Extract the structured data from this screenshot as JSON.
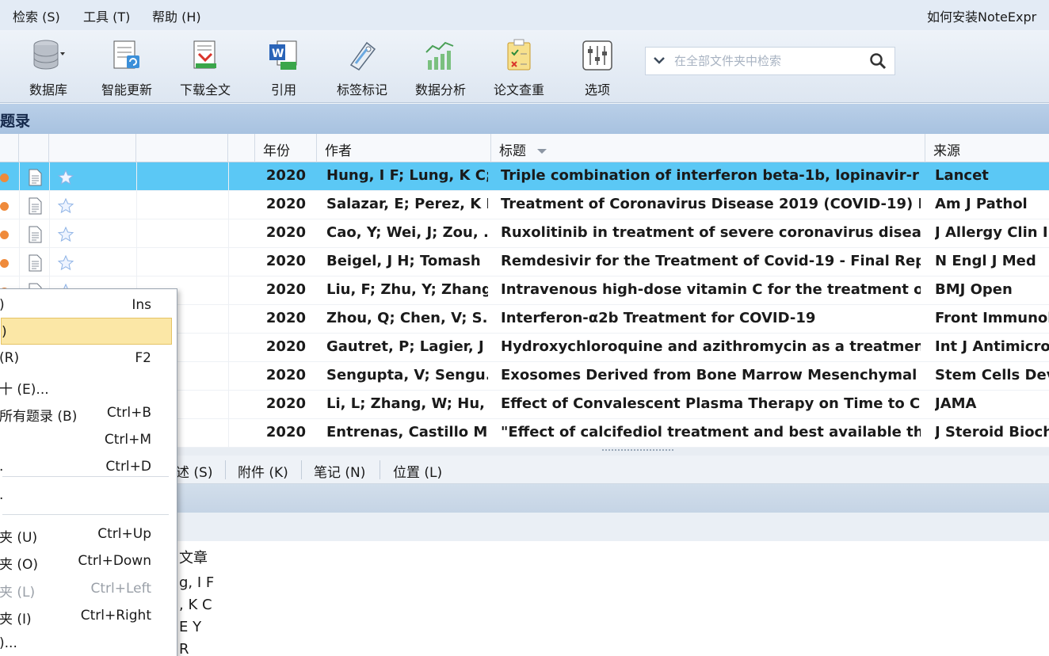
{
  "menubar": {
    "items": [
      "检索 (S)",
      "工具 (T)",
      "帮助 (H)"
    ],
    "help_link": "如何安装NoteExpr"
  },
  "toolbar": {
    "buttons": [
      {
        "label": "数据库",
        "icon": "database-icon"
      },
      {
        "label": "智能更新",
        "icon": "smart-update-icon"
      },
      {
        "label": "下载全文",
        "icon": "download-fulltext-icon"
      },
      {
        "label": "引用",
        "icon": "cite-word-icon"
      },
      {
        "label": "标签标记",
        "icon": "tag-icon"
      },
      {
        "label": "数据分析",
        "icon": "data-analysis-icon"
      },
      {
        "label": "论文查重",
        "icon": "plagiarism-check-icon"
      },
      {
        "label": "选项",
        "icon": "options-sliders-icon"
      }
    ],
    "search_placeholder": "在全部文件夹中检索"
  },
  "section": {
    "title": "题录"
  },
  "table": {
    "columns": {
      "year": "年份",
      "author": "作者",
      "title": "标题",
      "source": "来源"
    },
    "rows": [
      {
        "year": "2020",
        "author": "Hung, I F; Lung, K C;",
        "title": "Triple combination of interferon beta-1b, lopinavir-r",
        "source": "Lancet",
        "selected": true
      },
      {
        "year": "2020",
        "author": "Salazar, E; Perez, K I",
        "title": "Treatment of Coronavirus Disease 2019 (COVID-19) P",
        "source": "Am J Pathol"
      },
      {
        "year": "2020",
        "author": "Cao, Y; Wei, J; Zou, .",
        "title": "Ruxolitinib in treatment of severe coronavirus diseas",
        "source": "J Allergy Clin I"
      },
      {
        "year": "2020",
        "author": "Beigel, J H; Tomash",
        "title": "Remdesivir for the Treatment of Covid-19 - Final Rep",
        "source": "N Engl J Med"
      },
      {
        "year": "2020",
        "author": "Liu, F; Zhu, Y; Zhang.",
        "title": "Intravenous high-dose vitamin C for the treatment of",
        "source": "BMJ Open"
      },
      {
        "year": "2020",
        "author": "Zhou, Q; Chen, V; S..",
        "title": "Interferon-α2b Treatment for COVID-19",
        "source": "Front Immunol"
      },
      {
        "year": "2020",
        "author": "Gautret, P; Lagier, J",
        "title": "Hydroxychloroquine and azithromycin as a treatmen",
        "source": "Int J Antimicro"
      },
      {
        "year": "2020",
        "author": "Sengupta, V; Sengu.",
        "title": "Exosomes Derived from Bone Marrow Mesenchymal",
        "source": "Stem Cells Dev"
      },
      {
        "year": "2020",
        "author": "Li, L; Zhang, W; Hu, .",
        "title": "Effect of Convalescent Plasma Therapy on Time to Cli",
        "source": "JAMA"
      },
      {
        "year": "2020",
        "author": "Entrenas, Castillo M;",
        "title": "\"Effect of calcifediol treatment and best available the",
        "source": "J Steroid Bioch"
      }
    ]
  },
  "detail_tabs": [
    "述 (S)",
    "附件 (K)",
    "笔记 (N)",
    "位置 (L)"
  ],
  "detail_body": {
    "type_label": "文章",
    "authors": [
      "g, I F",
      ", K C",
      "E Y",
      "R"
    ]
  },
  "context_menu": {
    "items": [
      {
        "label": ")",
        "shortcut": "Ins"
      },
      {
        "label": ")",
        "shortcut": "",
        "highlighted": true
      },
      {
        "label": " (R)",
        "shortcut": "F2"
      },
      {
        "label": "十 (E)...",
        "shortcut": ""
      },
      {
        "label": "所有题录 (B)",
        "shortcut": "Ctrl+B"
      },
      {
        "label": "",
        "shortcut": "Ctrl+M"
      },
      {
        "label": ".",
        "shortcut": "Ctrl+D"
      },
      {
        "label": ".",
        "shortcut": ""
      },
      {
        "label": "夹 (U)",
        "shortcut": "Ctrl+Up"
      },
      {
        "label": "夹 (O)",
        "shortcut": "Ctrl+Down"
      },
      {
        "label": "夹 (L)",
        "shortcut": "Ctrl+Left",
        "disabled": true
      },
      {
        "label": "夹 (I)",
        "shortcut": "Ctrl+Right"
      },
      {
        "label": ")...",
        "shortcut": ""
      }
    ]
  }
}
